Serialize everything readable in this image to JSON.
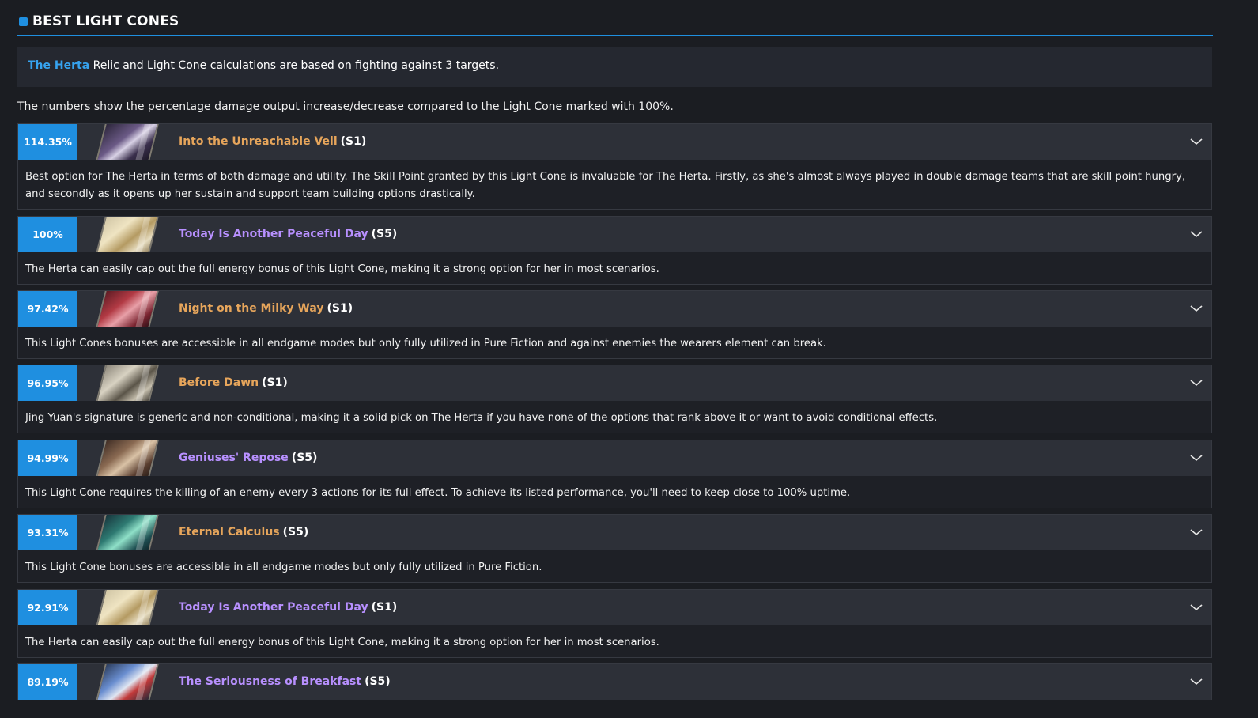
{
  "section": {
    "title": "BEST LIGHT CONES"
  },
  "info": {
    "character": "The Herta",
    "text": " Relic and Light Cone calculations are based on fighting against 3 targets."
  },
  "note": "The numbers show the percentage damage output increase/decrease compared to the Light Cone marked with 100%.",
  "colors": {
    "accent": "#1f8fe0",
    "gold_name": "#e6a55b",
    "purple_name": "#b890ff"
  },
  "cones": [
    {
      "percent": "114.35%",
      "name": "Into the Unreachable Veil",
      "rarity": "gold",
      "superimposition": "(S1)",
      "art": "dark-violet",
      "desc": "Best option for The Herta in terms of both damage and utility. The Skill Point granted by this Light Cone is invaluable for The Herta. Firstly, as she's almost always played in double damage teams that are skill point hungry, and secondly as it opens up her sustain and support team building options drastically."
    },
    {
      "percent": "100%",
      "name": "Today Is Another Peaceful Day",
      "rarity": "purple",
      "superimposition": "(S5)",
      "art": "blonde",
      "desc": "The Herta can easily cap out the full energy bonus of this Light Cone, making it a strong option for her in most scenarios."
    },
    {
      "percent": "97.42%",
      "name": "Night on the Milky Way",
      "rarity": "gold",
      "superimposition": "(S1)",
      "art": "crimson",
      "desc": "This Light Cones bonuses are accessible in all endgame modes but only fully utilized in Pure Fiction and against enemies the wearers element can break."
    },
    {
      "percent": "96.95%",
      "name": "Before Dawn",
      "rarity": "gold",
      "superimposition": "(S1)",
      "art": "pale",
      "desc": "Jing Yuan's signature is generic and non-conditional, making it a solid pick on The Herta if you have none of the options that rank above it or want to avoid conditional effects."
    },
    {
      "percent": "94.99%",
      "name": "Geniuses' Repose",
      "rarity": "purple",
      "superimposition": "(S5)",
      "art": "brown",
      "desc": "This Light Cone requires the killing of an enemy every 3 actions for its full effect. To achieve its listed performance, you'll need to keep close to 100% uptime."
    },
    {
      "percent": "93.31%",
      "name": "Eternal Calculus",
      "rarity": "gold",
      "superimposition": "(S5)",
      "art": "teal",
      "desc": "This Light Cone bonuses are accessible in all endgame modes but only fully utilized in Pure Fiction."
    },
    {
      "percent": "92.91%",
      "name": "Today Is Another Peaceful Day",
      "rarity": "purple",
      "superimposition": "(S1)",
      "art": "blonde",
      "desc": "The Herta can easily cap out the full energy bonus of this Light Cone, making it a strong option for her in most scenarios."
    },
    {
      "percent": "89.19%",
      "name": "The Seriousness of Breakfast",
      "rarity": "purple",
      "superimposition": "(S5)",
      "art": "blue",
      "desc": ""
    }
  ]
}
